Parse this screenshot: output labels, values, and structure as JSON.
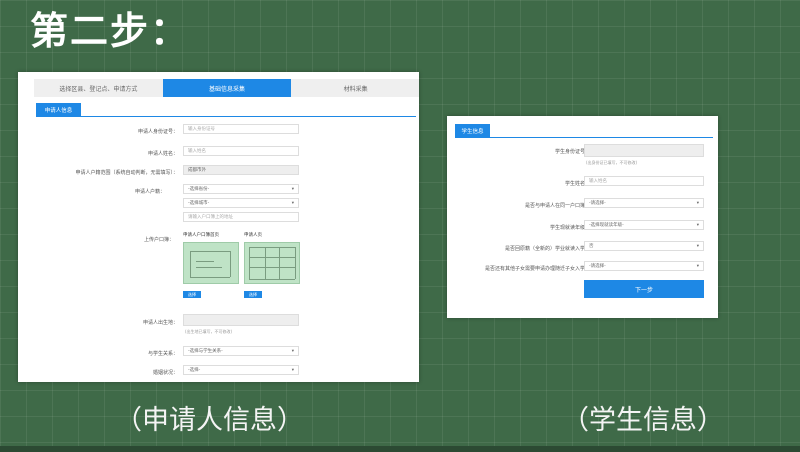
{
  "step_title": "第二步：",
  "captions": {
    "left": "（申请人信息）",
    "right": "（学生信息）"
  },
  "left": {
    "tabs": [
      "选择区县、登记点、申请方式",
      "基础信息采集",
      "材料采集"
    ],
    "section_title": "申请人信息",
    "fields": {
      "id_label": "申请人身份证号：",
      "id_placeholder": "输入身份证号",
      "name_label": "申请人姓名：",
      "name_placeholder": "输入姓名",
      "region_label": "申请人户籍范围（系统自动判断，无需填写）：",
      "region_value": "成都市外",
      "hukou_label": "申请人户籍：",
      "province_select": "-选择省份-",
      "city_select": "-选择城市-",
      "address_placeholder": "请输入户口簿上的地址",
      "upload_label": "上传户口簿：",
      "upload_img1_title": "申请人户口簿首页",
      "upload_img2_title": "申请人页",
      "choose_btn": "选择",
      "birth_label": "申请人出生地：",
      "birth_hint": "(出生地已填写，不可修改)",
      "relation_label": "与学生关系：",
      "relation_select": "-选择与学生关系-",
      "marital_label": "婚姻状况：",
      "marital_select": "-选择-"
    }
  },
  "right": {
    "section_title": "学生信息",
    "fields": {
      "id_label": "学生身份证号：",
      "id_hint": "(出身份证已填写，不可修改)",
      "name_label": "学生姓名：",
      "name_placeholder": "输入姓名",
      "same_hukou_label": "是否与申请人在同一户口簿：",
      "same_hukou_select": "-请选择-",
      "grade_label": "学生现就读年级：",
      "grade_select": "-选择现就读年级-",
      "school_label": "是否回原籍（全新的）学业就读入学：",
      "school_select": "否",
      "other_label": "是否还有其他子女需要申请办理随迁子女入学：",
      "other_select": "-请选择-",
      "next_button": "下一步"
    }
  },
  "colors": {
    "accent": "#1e88e5",
    "board": "#3f6a48"
  }
}
